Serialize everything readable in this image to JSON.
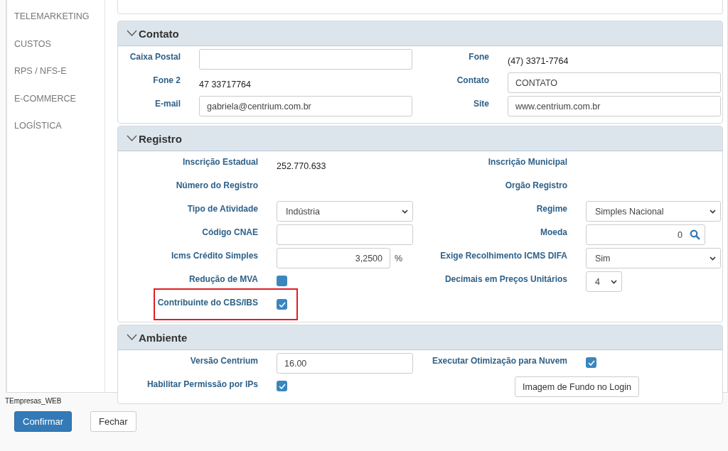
{
  "sidebar": {
    "items": [
      "TELEMARKETING",
      "CUSTOS",
      "RPS / NFS-E",
      "E-COMMERCE",
      "LOGÍSTICA"
    ]
  },
  "sections": [
    {
      "title": "Contato",
      "expanded": true,
      "rows": [
        {
          "fields": [
            {
              "label": "Caixa Postal",
              "kind": "input"
            },
            {
              "label": "Fone",
              "kind": "text",
              "value": "(47) 3371-7764"
            }
          ]
        },
        {
          "fields": [
            {
              "label": "Fone 2",
              "kind": "text",
              "value": "47 33717764"
            },
            {
              "label": "Contato",
              "kind": "input",
              "value": "CONTATO"
            }
          ]
        },
        {
          "fields": [
            {
              "label": "E-mail",
              "kind": "input",
              "value": "gabriela@centrium.com.br"
            },
            {
              "label": "Site",
              "kind": "input",
              "value": "www.centrium.com.br"
            }
          ]
        }
      ]
    },
    {
      "title": "Registro",
      "expanded": true,
      "rows": [
        {
          "fields": [
            {
              "label": "Inscrição Estadual",
              "kind": "text",
              "value": "252.770.633"
            },
            {
              "label": "Inscrição Municipal",
              "kind": "label"
            }
          ]
        },
        {
          "fields": [
            {
              "label": "Número do Registro",
              "kind": "label"
            },
            {
              "label": "Orgão Registro",
              "kind": "label"
            }
          ]
        },
        {
          "fields": [
            {
              "label": "Tipo de Atividade",
              "kind": "select",
              "value": "Indústria"
            },
            {
              "label": "Regime",
              "kind": "select",
              "value": "Simples Nacional"
            }
          ]
        },
        {
          "fields": [
            {
              "label": "Código CNAE",
              "kind": "input"
            },
            {
              "label": "Moeda",
              "kind": "lookup",
              "value": "0"
            }
          ]
        },
        {
          "fields": [
            {
              "label": "Icms Crédito Simples",
              "kind": "number",
              "value": "3,2500",
              "unit": "%"
            },
            {
              "label": "Exige Recolhimento ICMS DIFA",
              "kind": "select",
              "value": "Sim"
            }
          ]
        },
        {
          "fields": [
            {
              "label": "Redução de MVA",
              "kind": "checkbox",
              "checked": false
            },
            {
              "label": "Decimais em Preços Unitários",
              "kind": "small-select",
              "value": "4"
            }
          ]
        },
        {
          "fields": [
            {
              "label": "Contribuinte do CBS/IBS",
              "kind": "checkbox",
              "checked": true,
              "highlighted": true
            }
          ]
        }
      ]
    },
    {
      "title": "Ambiente",
      "expanded": true,
      "rows": [
        {
          "fields": [
            {
              "label": "Versão Centrium",
              "kind": "input",
              "value": "16.00"
            },
            {
              "label": "Executar Otimização para Nuvem",
              "kind": "checkbox",
              "checked": true
            }
          ]
        },
        {
          "fields": [
            {
              "label": "Habilitar Permissão por IPs",
              "kind": "checkbox",
              "checked": true
            },
            {
              "kind": "button",
              "value": "Imagem de Fundo no Login"
            }
          ]
        }
      ]
    }
  ],
  "form_name": "TEmpresas_WEB",
  "buttons": [
    {
      "label": "Confirmar",
      "kind": "primary"
    },
    {
      "label": "Fechar",
      "kind": "default"
    }
  ]
}
